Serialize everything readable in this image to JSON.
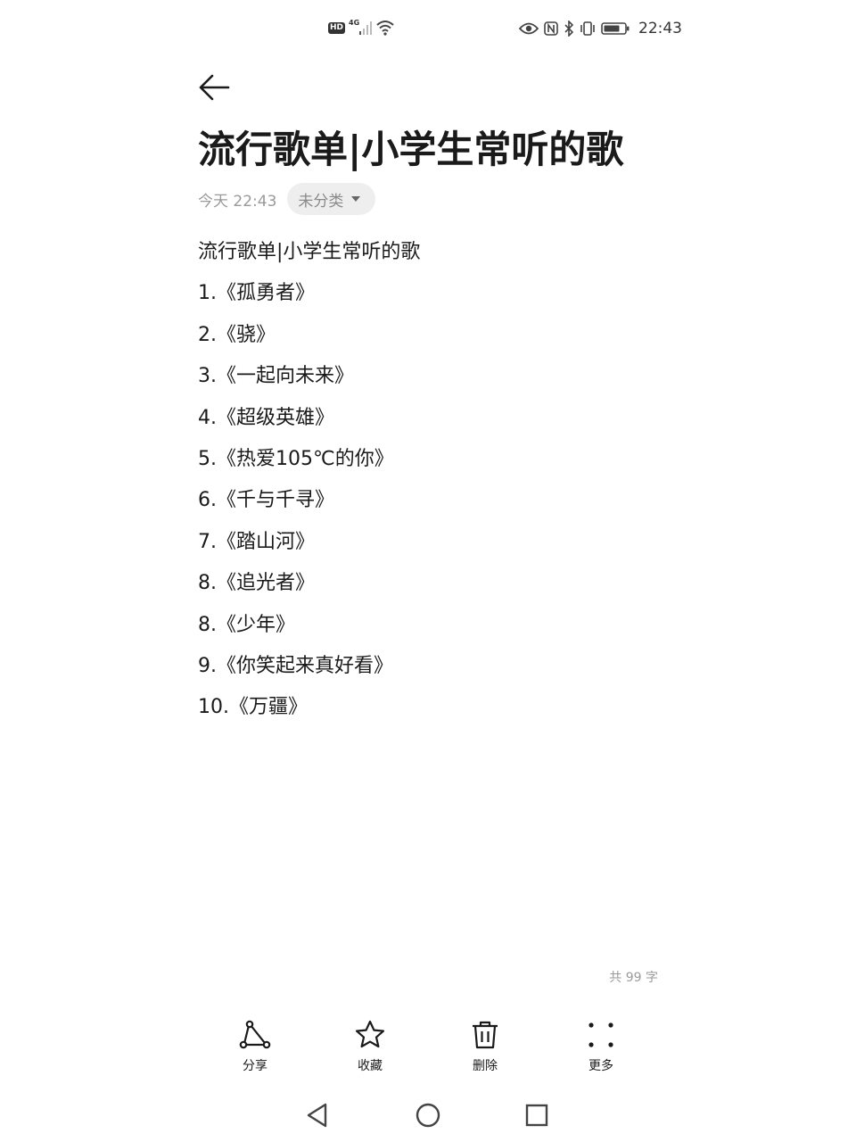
{
  "status_bar": {
    "hd_badge": "HD",
    "network_type": "4G",
    "time": "22:43",
    "left_icons": [
      "hd-icon",
      "signal-icon",
      "wifi-icon"
    ],
    "right_icons": [
      "eye-icon",
      "nfc-icon",
      "bluetooth-icon",
      "vibrate-icon",
      "battery-icon"
    ]
  },
  "note": {
    "title": "流行歌单|小学生常听的歌",
    "timestamp": "今天 22:43",
    "category": "未分类",
    "lines": [
      "流行歌单|小学生常听的歌",
      "1.《孤勇者》",
      "2.《骁》",
      "3.《一起向未来》",
      "4.《超级英雄》",
      "5.《热爱105℃的你》",
      "6.《千与千寻》",
      "7.《踏山河》",
      "8.《追光者》",
      "8.《少年》",
      "9.《你笑起来真好看》",
      "10.《万疆》"
    ],
    "word_count": "共 99 字"
  },
  "toolbar": {
    "share": "分享",
    "favorite": "收藏",
    "delete": "删除",
    "more": "更多"
  },
  "nav_icons": [
    "back-triangle-icon",
    "home-circle-icon",
    "recents-square-icon"
  ],
  "colors": {
    "text": "#1a1a1a",
    "muted": "#9a9a9a",
    "chip_bg": "#eeeeee",
    "background": "#ffffff"
  }
}
